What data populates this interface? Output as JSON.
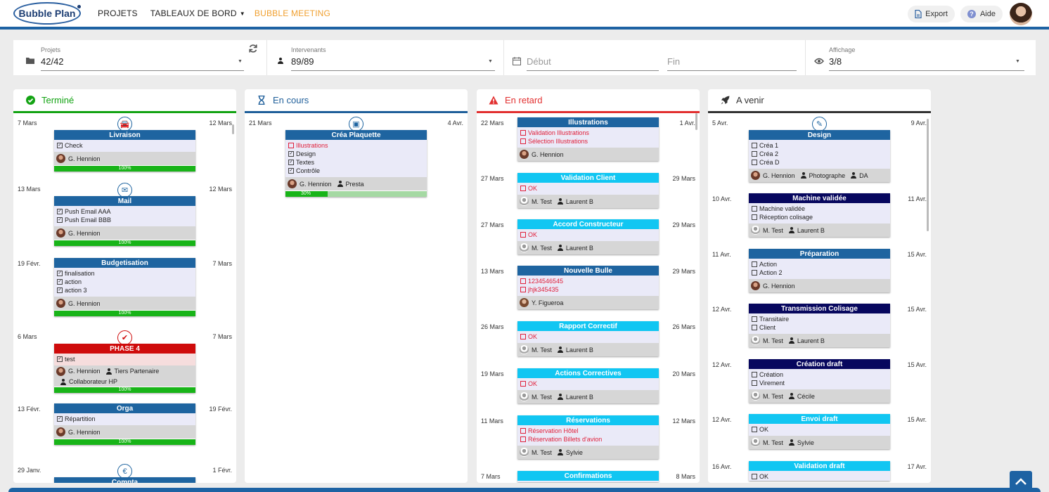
{
  "app": {
    "logo": "Bubble Plan"
  },
  "nav": [
    {
      "label": "PROJETS"
    },
    {
      "label": "TABLEAUX DE BORD",
      "caret": "▼"
    },
    {
      "label": "BUBBLE MEETING"
    }
  ],
  "topright": {
    "export": "Export",
    "help": "Aide"
  },
  "filters": {
    "projets": {
      "label": "Projets",
      "value": "42/42"
    },
    "intervenants": {
      "label": "Intervenants",
      "value": "89/89"
    },
    "debut": {
      "placeholder": "Début"
    },
    "fin": {
      "placeholder": "Fin"
    },
    "affichage": {
      "label": "Affichage",
      "value": "3/8"
    }
  },
  "colors": {
    "done": "#13a313",
    "progress": "#1f5f9a",
    "late": "#e23030",
    "upcoming": "#333333",
    "dark": "#1e64a0",
    "cyan": "#11c6f2",
    "red": "#cf0b0b",
    "navy": "#07075e",
    "progressGreen": "#18b418"
  },
  "columns": [
    {
      "title": "Terminé",
      "icon": "check-circle-icon",
      "color": "#13a313",
      "cards": [
        {
          "start": "7 Mars",
          "end": "12 Mars",
          "icon": "car-icon",
          "icon_glyph": "🚘",
          "title": "Livraison",
          "style": "dark",
          "tasks": [
            {
              "label": "Check",
              "checked": true
            }
          ],
          "people": [
            {
              "avatar": "m",
              "name": "G. Hennion"
            }
          ],
          "progress": 100,
          "progress_label": "100%"
        },
        {
          "start": "13 Mars",
          "end": "12 Mars",
          "icon": "mail-icon",
          "icon_glyph": "✉",
          "title": "Mail",
          "style": "dark",
          "tasks": [
            {
              "label": "Push Email AAA",
              "checked": true
            },
            {
              "label": "Push Email BBB",
              "checked": true
            }
          ],
          "people": [
            {
              "avatar": "m",
              "name": "G. Hennion"
            }
          ],
          "progress": 100,
          "progress_label": "100%"
        },
        {
          "start": "19 Févr.",
          "end": "7 Mars",
          "title": "Budgetisation",
          "style": "dark",
          "tasks": [
            {
              "label": "finalisation",
              "checked": true
            },
            {
              "label": "action",
              "checked": true
            },
            {
              "label": "action 3",
              "checked": true
            }
          ],
          "people": [
            {
              "avatar": "m",
              "name": "G. Hennion"
            }
          ],
          "progress": 100,
          "progress_label": "100%"
        },
        {
          "start": "6 Mars",
          "end": "7 Mars",
          "icon": "check-icon",
          "icon_glyph": "✔",
          "title": "PHASE 4",
          "style": "red",
          "tasks": [
            {
              "label": "test",
              "checked": true
            }
          ],
          "people": [
            {
              "avatar": "m",
              "name": "G. Hennion"
            },
            {
              "avatar": "p",
              "name": "Tiers Partenaire"
            }
          ],
          "people2": [
            {
              "avatar": "p",
              "name": "Collaborateur HP"
            }
          ],
          "progress": 100,
          "progress_label": "100%"
        },
        {
          "start": "13 Févr.",
          "end": "19 Févr.",
          "title": "Orga",
          "style": "dark",
          "tasks": [
            {
              "label": "Répartition",
              "checked": true
            }
          ],
          "people": [
            {
              "avatar": "m",
              "name": "G. Hennion"
            }
          ],
          "progress": 100,
          "progress_label": "100%"
        },
        {
          "start": "29 Janv.",
          "end": "1 Févr.",
          "icon": "euro-icon",
          "icon_glyph": "€",
          "title": "Compta",
          "style": "dark",
          "tasks": [],
          "people": []
        }
      ]
    },
    {
      "title": "En cours",
      "icon": "hourglass-icon",
      "color": "#1f5f9a",
      "cards": [
        {
          "start": "21 Mars",
          "end": "4 Avr.",
          "icon": "image-icon",
          "icon_glyph": "▣",
          "title": "Créa Plaquette",
          "style": "dark",
          "tasks": [
            {
              "label": "Illustrations",
              "checked": false,
              "late": true
            },
            {
              "label": "Design",
              "checked": true
            },
            {
              "label": "Textes",
              "checked": true
            },
            {
              "label": "Contrôle",
              "checked": true
            }
          ],
          "people": [
            {
              "avatar": "m",
              "name": "G. Hennion"
            },
            {
              "avatar": "p",
              "name": "Presta"
            }
          ],
          "progress": 30,
          "progress_label": "30%"
        }
      ]
    },
    {
      "title": "En retard",
      "icon": "warning-icon",
      "color": "#e23030",
      "cards": [
        {
          "start": "22 Mars",
          "end": "1 Avr.",
          "title": "Illustrations",
          "style": "dark",
          "tasks": [
            {
              "label": "Validation Illustrations",
              "late": true
            },
            {
              "label": "Sélection Illustrations",
              "late": true
            }
          ],
          "people": [
            {
              "avatar": "m",
              "name": "G. Hennion"
            }
          ]
        },
        {
          "start": "27 Mars",
          "end": "29 Mars",
          "title": "Validation Client",
          "style": "cyan",
          "tasks": [
            {
              "label": "OK",
              "late": true
            }
          ],
          "people": [
            {
              "avatar": "g",
              "name": "M. Test"
            },
            {
              "avatar": "p",
              "name": "Laurent B"
            }
          ]
        },
        {
          "start": "27 Mars",
          "end": "29 Mars",
          "title": "Accord Constructeur",
          "style": "cyan",
          "tasks": [
            {
              "label": "OK",
              "late": true
            }
          ],
          "people": [
            {
              "avatar": "g",
              "name": "M. Test"
            },
            {
              "avatar": "p",
              "name": "Laurent B"
            }
          ]
        },
        {
          "start": "13 Mars",
          "end": "29 Mars",
          "title": "Nouvelle Bulle",
          "style": "dark",
          "tasks": [
            {
              "label": "1234546545",
              "late": true
            },
            {
              "label": "jhjk345435",
              "late": true
            }
          ],
          "people": [
            {
              "avatar": "w",
              "name": "Y. Figueroa"
            }
          ]
        },
        {
          "start": "26 Mars",
          "end": "26 Mars",
          "title": "Rapport Correctif",
          "style": "cyan",
          "tasks": [
            {
              "label": "OK",
              "late": true
            }
          ],
          "people": [
            {
              "avatar": "g",
              "name": "M. Test"
            },
            {
              "avatar": "p",
              "name": "Laurent B"
            }
          ]
        },
        {
          "start": "19 Mars",
          "end": "20 Mars",
          "title": "Actions Correctives",
          "style": "cyan",
          "tasks": [
            {
              "label": "OK",
              "late": true
            }
          ],
          "people": [
            {
              "avatar": "g",
              "name": "M. Test"
            },
            {
              "avatar": "p",
              "name": "Laurent B"
            }
          ]
        },
        {
          "start": "11 Mars",
          "end": "12 Mars",
          "title": "Réservations",
          "style": "cyan",
          "tasks": [
            {
              "label": "Réservation Hôtel",
              "late": true
            },
            {
              "label": "Réservation Billets d'avion",
              "late": true
            }
          ],
          "people": [
            {
              "avatar": "g",
              "name": "M. Test"
            },
            {
              "avatar": "p",
              "name": "Sylvie"
            }
          ]
        },
        {
          "start": "7 Mars",
          "end": "8 Mars",
          "title": "Confirmations",
          "style": "cyan",
          "tasks": [],
          "people": []
        }
      ]
    },
    {
      "title": "A venir",
      "icon": "rocket-icon",
      "color": "#333333",
      "cards": [
        {
          "start": "5 Avr.",
          "end": "9 Avr.",
          "icon": "edit-icon",
          "icon_glyph": "✎",
          "title": "Design",
          "style": "dark",
          "tasks": [
            {
              "label": "Créa 1"
            },
            {
              "label": "Créa 2"
            },
            {
              "label": "Créa D"
            }
          ],
          "people": [
            {
              "avatar": "m",
              "name": "G. Hennion"
            },
            {
              "avatar": "p",
              "name": "Photographe"
            },
            {
              "avatar": "p",
              "name": "DA"
            }
          ]
        },
        {
          "start": "10 Avr.",
          "end": "11 Avr.",
          "title": "Machine validée",
          "style": "navy",
          "tasks": [
            {
              "label": "Machine validée"
            },
            {
              "label": "Réception colisage"
            }
          ],
          "people": [
            {
              "avatar": "g",
              "name": "M. Test"
            },
            {
              "avatar": "p",
              "name": "Laurent B"
            }
          ]
        },
        {
          "start": "11 Avr.",
          "end": "15 Avr.",
          "title": "Préparation",
          "style": "dark",
          "tasks": [
            {
              "label": "Action"
            },
            {
              "label": "Action 2"
            }
          ],
          "people": [
            {
              "avatar": "m",
              "name": "G. Hennion"
            }
          ]
        },
        {
          "start": "12 Avr.",
          "end": "15 Avr.",
          "title": "Transmission Colisage",
          "style": "navy",
          "tasks": [
            {
              "label": "Transitaire"
            },
            {
              "label": "Client"
            }
          ],
          "people": [
            {
              "avatar": "g",
              "name": "M. Test"
            },
            {
              "avatar": "p",
              "name": "Laurent B"
            }
          ]
        },
        {
          "start": "12 Avr.",
          "end": "15 Avr.",
          "title": "Création draft",
          "style": "navy",
          "tasks": [
            {
              "label": "Création"
            },
            {
              "label": "Virement"
            }
          ],
          "people": [
            {
              "avatar": "g",
              "name": "M. Test"
            },
            {
              "avatar": "p",
              "name": "Cécile"
            }
          ]
        },
        {
          "start": "12 Avr.",
          "end": "15 Avr.",
          "title": "Envoi draft",
          "style": "cyan",
          "tasks": [
            {
              "label": "OK"
            }
          ],
          "people": [
            {
              "avatar": "g",
              "name": "M. Test"
            },
            {
              "avatar": "p",
              "name": "Sylvie"
            }
          ]
        },
        {
          "start": "16 Avr.",
          "end": "17 Avr.",
          "title": "Validation draft",
          "style": "cyan",
          "tasks": [
            {
              "label": "OK"
            }
          ],
          "people": []
        }
      ]
    }
  ]
}
